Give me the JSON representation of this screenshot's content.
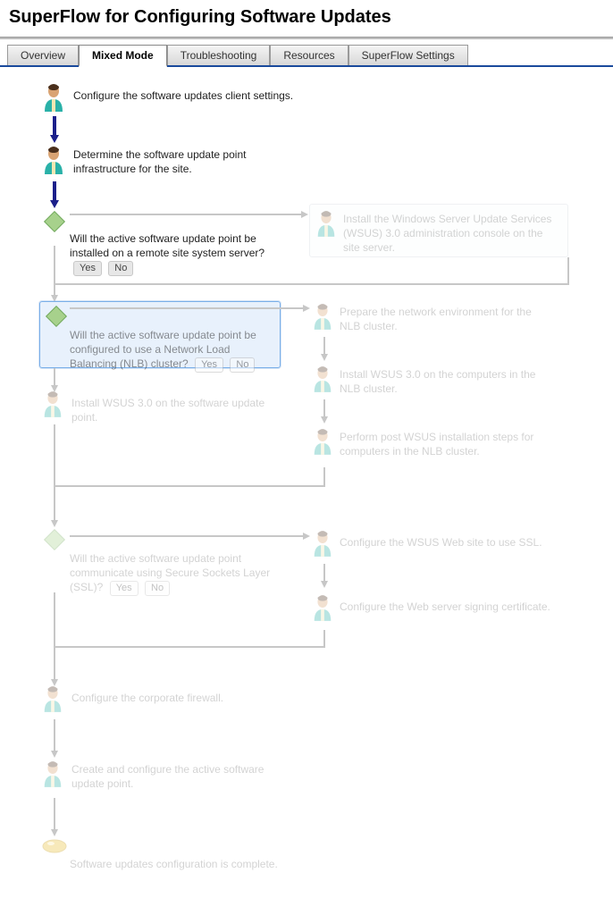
{
  "header": {
    "title": "SuperFlow for Configuring Software Updates"
  },
  "tabs": [
    {
      "label": "Overview",
      "active": false
    },
    {
      "label": "Mixed Mode",
      "active": true
    },
    {
      "label": "Troubleshooting",
      "active": false
    },
    {
      "label": "Resources",
      "active": false
    },
    {
      "label": "SuperFlow Settings",
      "active": false
    }
  ],
  "buttons": {
    "yes": "Yes",
    "no": "No"
  },
  "steps": {
    "s1": "Configure the software updates client settings.",
    "s2": "Determine the software update point infrastructure for the site.",
    "d1": "Will the active software update point be installed on a remote site system server?",
    "r1": "Install the Windows Server Update Services (WSUS) 3.0 administration console on the site server.",
    "d2": "Will the active software update point be configured to use a Network Load Balancing (NLB) cluster?",
    "r2": "Prepare the network environment for the NLB cluster.",
    "r3": "Install WSUS 3.0 on the computers in the NLB cluster.",
    "r4": "Perform post WSUS installation steps for computers in the NLB cluster.",
    "s3": "Install WSUS 3.0 on the software update point.",
    "d3": "Will the active software update point communicate using Secure Sockets Layer (SSL)?",
    "r5": "Configure the WSUS Web site to use SSL.",
    "r6": "Configure the Web server signing certificate.",
    "s4": "Configure the corporate firewall.",
    "s5": "Create and configure the active software update point.",
    "end": "Software updates configuration is complete."
  }
}
